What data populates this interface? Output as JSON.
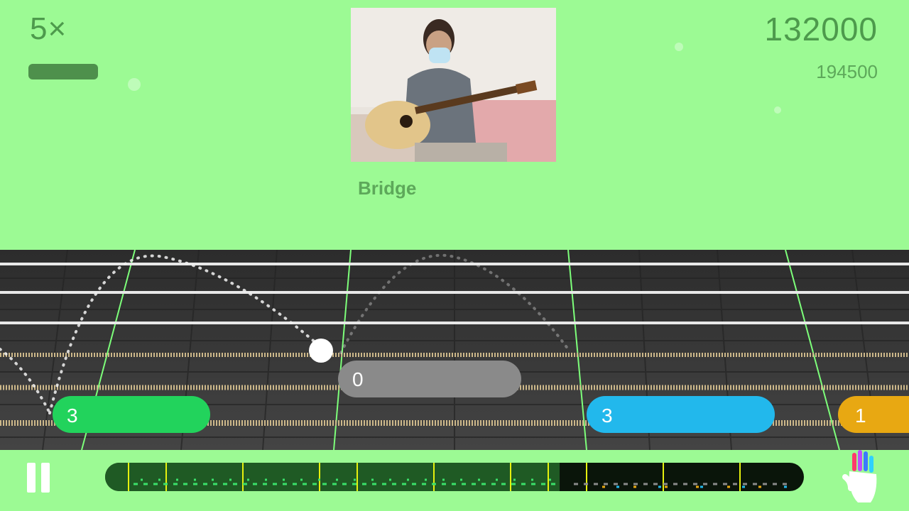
{
  "hud": {
    "multiplier": "5×",
    "score": "132000",
    "best_score": "194500",
    "section": "Bridge"
  },
  "notes": [
    {
      "fret": "3",
      "color": "#22d35c"
    },
    {
      "fret": "0",
      "color": "#8a8a8a"
    },
    {
      "fret": "3",
      "color": "#22b8ec"
    },
    {
      "fret": "1",
      "color": "#e8a812"
    }
  ],
  "icons": {
    "pause": "pause-icon",
    "hand": "hand-icon"
  },
  "colors": {
    "background": "#9cfa94",
    "fretboard": "#3a3a3a",
    "fret_line": "#7dff7a",
    "timeline_progress": "#1f5a24"
  }
}
